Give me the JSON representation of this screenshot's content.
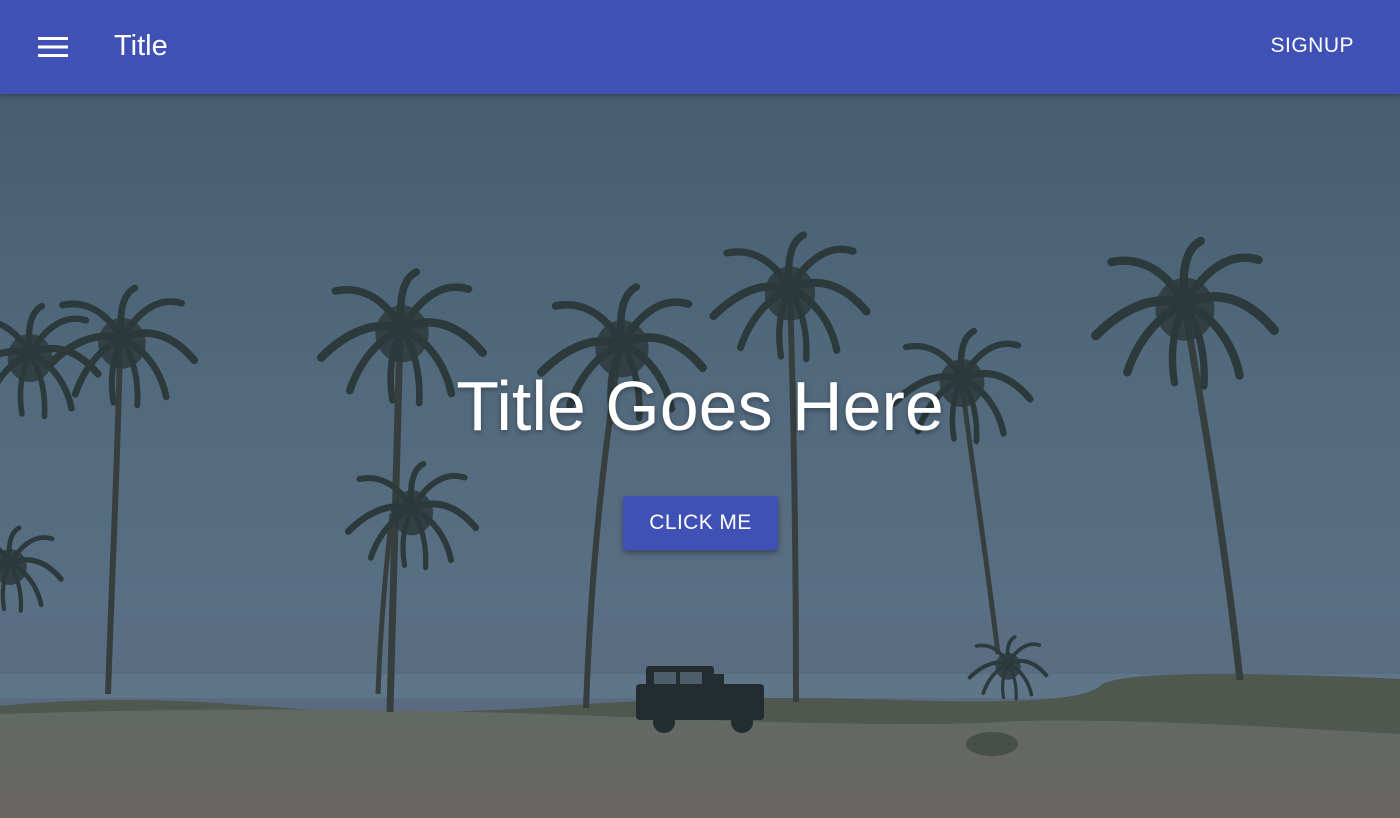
{
  "app_bar": {
    "title": "Title",
    "signup_label": "SIGNUP",
    "menu_icon": "hamburger-menu-icon",
    "background_color": "#3f51b5"
  },
  "hero": {
    "title": "Title Goes Here",
    "cta_label": "CLICK ME",
    "cta_color": "#3f51b5",
    "background_image": "beach with palm trees and a jeep"
  }
}
